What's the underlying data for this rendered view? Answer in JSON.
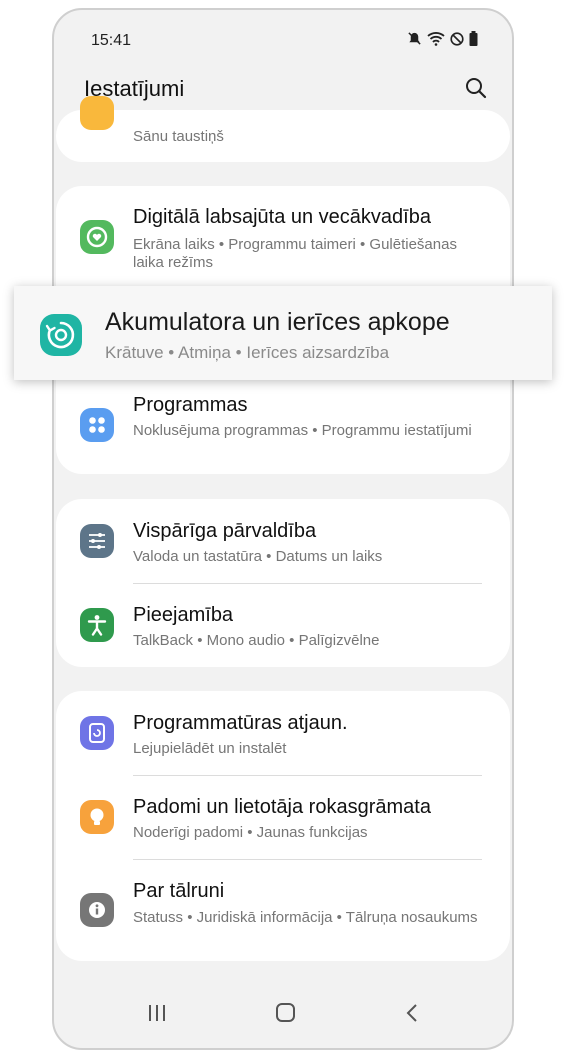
{
  "status_bar": {
    "time": "15:41",
    "icons": [
      "mute-icon",
      "wifi-icon",
      "no-disturb-icon",
      "battery-icon"
    ]
  },
  "header": {
    "title": "Iestatījumi"
  },
  "groups": [
    {
      "items": [
        {
          "title": "",
          "subtitle": "Sānu taustiņš",
          "icon": "side-key-icon",
          "color": "#f9b83c"
        }
      ]
    },
    {
      "items": [
        {
          "title": "Digitālā labsajūta un vecākvadība",
          "subtitle": "Ekrāna laiks  •  Programmu taimeri  •  Gulētiešanas laika režīms",
          "icon": "wellbeing-icon",
          "color": "#53b95e"
        }
      ]
    },
    {
      "items": [
        {
          "title": "Programmas",
          "subtitle": "Noklusējuma programmas  •  Programmu iestatījumi",
          "icon": "apps-icon",
          "color": "#5a9df0"
        }
      ]
    },
    {
      "items": [
        {
          "title": "Vispārīga pārvaldība",
          "subtitle": "Valoda un tastatūra  •  Datums un laiks",
          "icon": "general-management-icon",
          "color": "#5d7589"
        },
        {
          "title": "Pieejamība",
          "subtitle": "TalkBack  •  Mono audio  •  Palīgizvēlne",
          "icon": "accessibility-icon",
          "color": "#2f9a4d"
        }
      ]
    },
    {
      "items": [
        {
          "title": "Programmatūras atjaun.",
          "subtitle": "Lejupielādēt un instalēt",
          "icon": "software-update-icon",
          "color": "#6f74e6"
        },
        {
          "title": "Padomi un lietotāja rokasgrāmata",
          "subtitle": "Noderīgi padomi  •  Jaunas funkcijas",
          "icon": "tips-icon",
          "color": "#f7a23c"
        },
        {
          "title": "Par tālruni",
          "subtitle": "Statuss  •  Juridiskā informācija  •  Tālruņa nosaukums",
          "icon": "info-icon",
          "color": "#767676"
        }
      ]
    }
  ],
  "highlight": {
    "title": "Akumulatora un ierīces apkope",
    "subtitle": "Krātuve  •  Atmiņa  •  Ierīces aizsardzība",
    "icon": "device-care-icon",
    "color": "#1fb5a4"
  },
  "nav": [
    "recent-apps-icon",
    "home-icon",
    "back-icon"
  ]
}
